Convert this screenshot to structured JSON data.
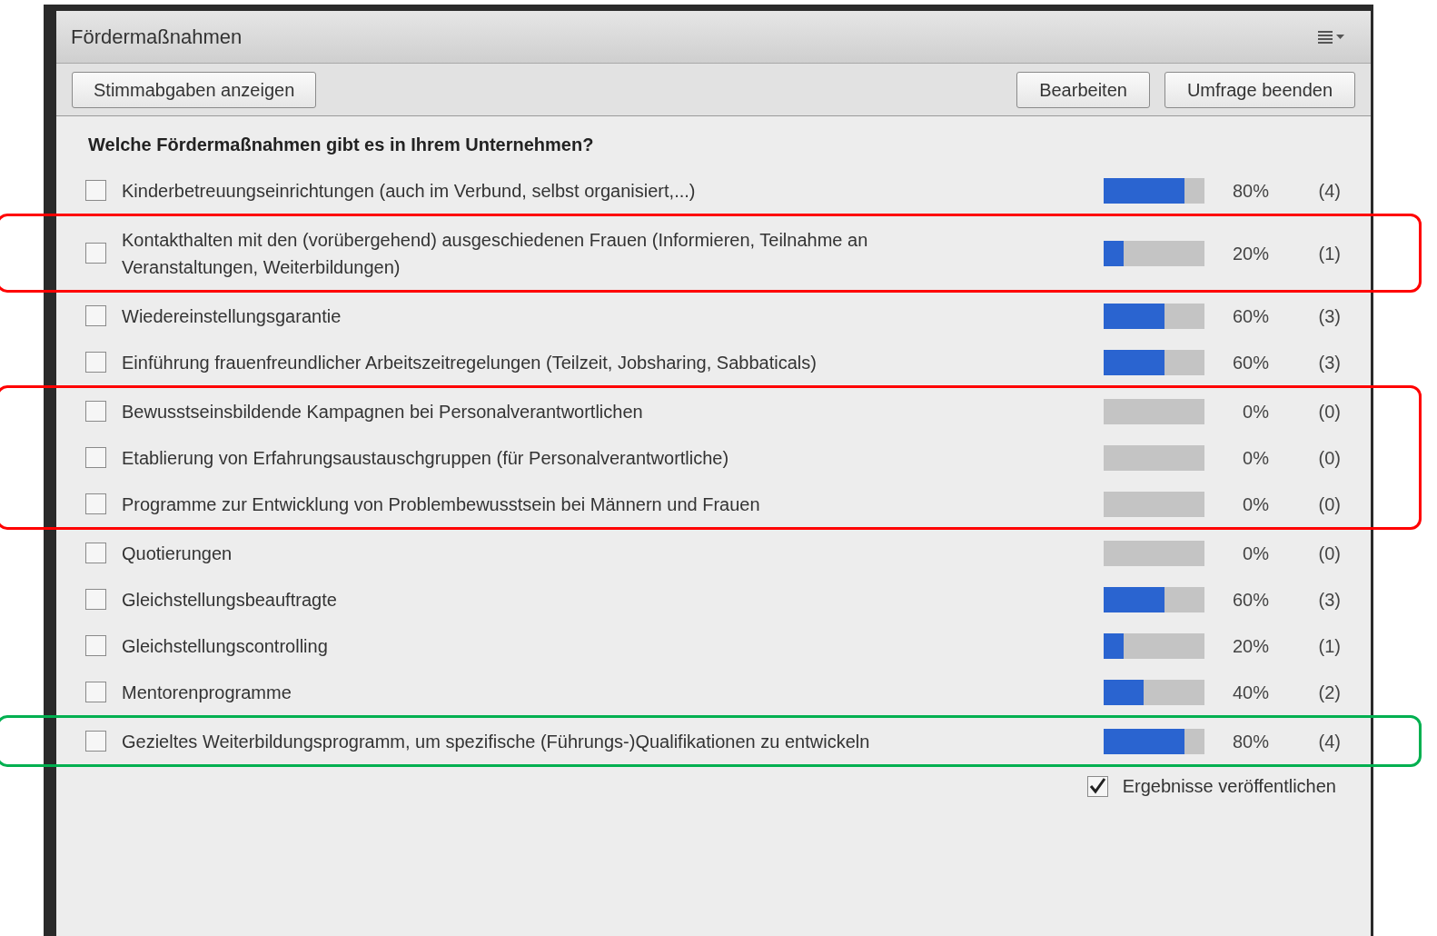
{
  "panel": {
    "title": "Fördermaßnahmen"
  },
  "toolbar": {
    "left_buttons": [
      "Stimmabgaben anzeigen"
    ],
    "right_buttons": [
      "Bearbeiten",
      "Umfrage beenden"
    ]
  },
  "question": "Welche Fördermaßnahmen gibt es in Ihrem Unternehmen?",
  "options": [
    {
      "label": "Kinderbetreuungseinrichtungen (auch im Verbund, selbst organisiert,...)",
      "checked": false,
      "level": 0.8,
      "percent": "80%",
      "count": "(4)"
    },
    {
      "label": "Kontakthalten mit den (vorübergehend) ausgeschiedenen Frauen (Informieren, Teilnahme an Veranstaltungen, Weiterbildungen)",
      "checked": false,
      "level": 0.2,
      "percent": "20%",
      "count": "(1)",
      "color": "#ff0000"
    },
    {
      "label": "Wiedereinstellungsgarantie",
      "checked": false,
      "level": 0.6,
      "percent": "60%",
      "count": "(3)"
    },
    {
      "label": "Einführung frauenfreundlicher Arbeitszeitregelungen (Teilzeit, Jobsharing, Sabbaticals)",
      "checked": false,
      "level": 0.6,
      "percent": "60%",
      "count": "(3)"
    },
    {
      "label": "Bewusstseinsbildende Kampagnen bei Personalverantwortlichen",
      "checked": false,
      "level": 0,
      "percent": "0%",
      "count": "(0)",
      "color": "#ff0000"
    },
    {
      "label": "Etablierung von Erfahrungsaustauschgruppen (für Personalverantwortliche)",
      "checked": false,
      "level": 0,
      "percent": "0%",
      "count": "(0)",
      "color": "#ff0000"
    },
    {
      "label": "Programme zur Entwicklung von Problembewusstsein bei Männern und Frauen",
      "checked": false,
      "level": 0,
      "percent": "0%",
      "count": "(0)",
      "color": "#ff0000"
    },
    {
      "label": "Quotierungen",
      "checked": false,
      "level": 0,
      "percent": "0%",
      "count": "(0)"
    },
    {
      "label": "Gleichstellungsbeauftragte",
      "checked": false,
      "level": 0.6,
      "percent": "60%",
      "count": "(3)"
    },
    {
      "label": "Gleichstellungscontrolling",
      "checked": false,
      "level": 0.2,
      "percent": "20%",
      "count": "(1)"
    },
    {
      "label": "Mentorenprogramme",
      "checked": false,
      "level": 0.4,
      "percent": "40%",
      "count": "(2)"
    },
    {
      "label": "Gezieltes Weiterbildungsprogramm, um spezifische (Führungs-)Qualifikationen zu entwickeln",
      "checked": false,
      "level": 0.8,
      "percent": "80%",
      "count": "(4)",
      "color": "#00b050"
    }
  ],
  "publish": {
    "label": "Ergebnisse veröffentlichen",
    "checked": true
  }
}
